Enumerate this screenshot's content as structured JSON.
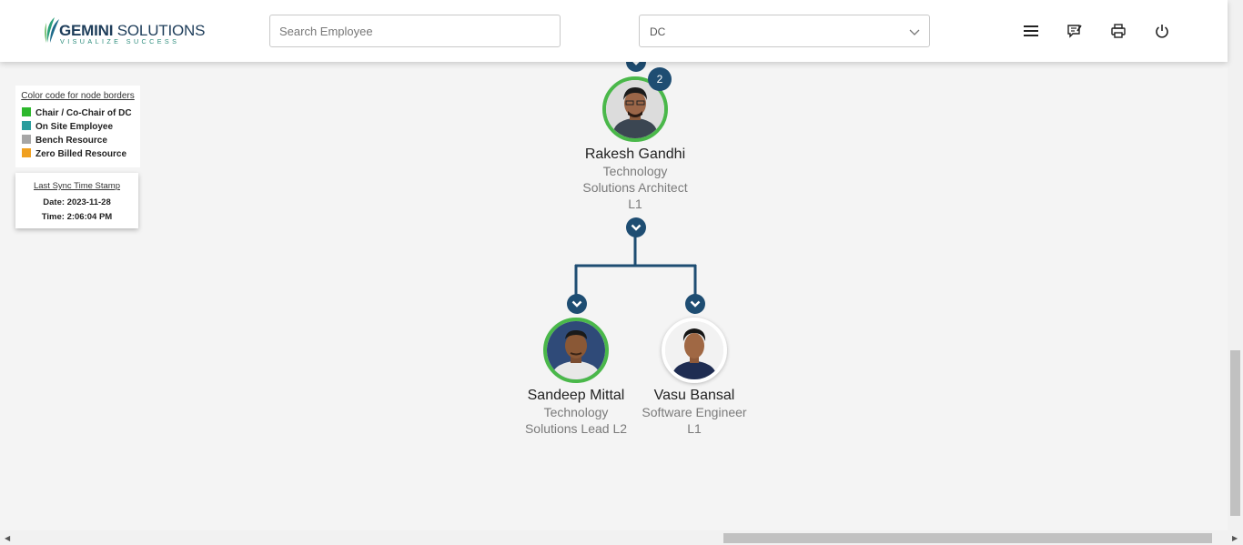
{
  "header": {
    "brand_bold": "GEMINI",
    "brand_rest": " SOLUTIONS",
    "tagline": "VISUALIZE SUCCESS",
    "search_placeholder": "Search Employee",
    "select_value": "DC",
    "icons": [
      "menu-icon",
      "feedback-icon",
      "print-icon",
      "power-icon"
    ]
  },
  "legend": {
    "title": "Color code for node borders",
    "items": [
      {
        "label": "Chair / Co-Chair of DC",
        "color": "#2db82d"
      },
      {
        "label": "On Site Employee",
        "color": "#2a9d9d"
      },
      {
        "label": "Bench Resource",
        "color": "#a6a6a6"
      },
      {
        "label": "Zero Billed Resource",
        "color": "#f0a020"
      }
    ]
  },
  "sync": {
    "title": "Last Sync Time Stamp",
    "date": "Date: 2023-11-28",
    "time": "Time: 2:06:04 PM"
  },
  "nodes": {
    "root": {
      "name": "Rakesh Gandhi",
      "dept": "Technology",
      "role": "Solutions Architect",
      "level": "L1",
      "badge": "2",
      "border": "#4ab84a"
    },
    "child1": {
      "name": "Sandeep Mittal",
      "dept": "Technology",
      "role": "Solutions Lead L2",
      "border": "#4ab84a"
    },
    "child2": {
      "name": "Vasu Bansal",
      "dept": "Software Engineer",
      "role": "L1",
      "border": "#ffffff"
    }
  },
  "colors": {
    "accent": "#1e4d72",
    "connector": "#1e4d72"
  }
}
